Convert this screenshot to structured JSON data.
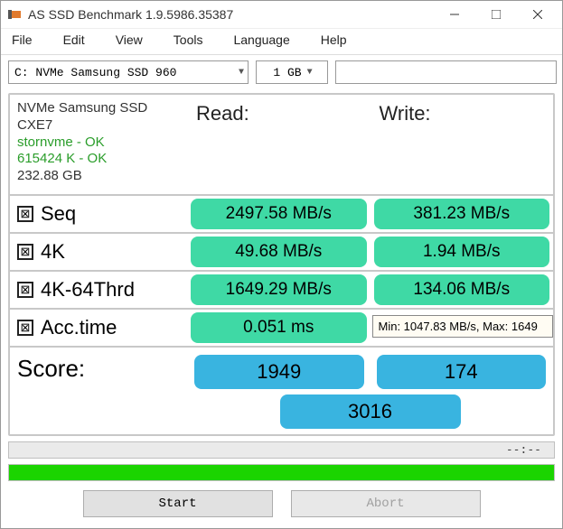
{
  "window": {
    "title": "AS SSD Benchmark 1.9.5986.35387"
  },
  "menu": {
    "file": "File",
    "edit": "Edit",
    "view": "View",
    "tools": "Tools",
    "language": "Language",
    "help": "Help"
  },
  "controls": {
    "drive": "C: NVMe Samsung SSD 960",
    "size": "1 GB"
  },
  "info": {
    "name": "NVMe Samsung SSD",
    "fw": "CXE7",
    "driver": "stornvme - OK",
    "align": "615424 K - OK",
    "cap": "232.88 GB"
  },
  "headers": {
    "read": "Read:",
    "write": "Write:"
  },
  "rows": {
    "seq": {
      "label": "Seq",
      "read": "2497.58 MB/s",
      "write": "381.23 MB/s"
    },
    "k4": {
      "label": "4K",
      "read": "49.68 MB/s",
      "write": "1.94 MB/s"
    },
    "k464": {
      "label": "4K-64Thrd",
      "read": "1649.29 MB/s",
      "write": "134.06 MB/s"
    },
    "acc": {
      "label": "Acc.time",
      "read": "0.051 ms",
      "write": ""
    }
  },
  "tooltip": "Min: 1047.83 MB/s, Max: 1649",
  "score": {
    "label": "Score:",
    "read": "1949",
    "write": "174",
    "total": "3016"
  },
  "progress_text": "--:--",
  "buttons": {
    "start": "Start",
    "abort": "Abort"
  }
}
